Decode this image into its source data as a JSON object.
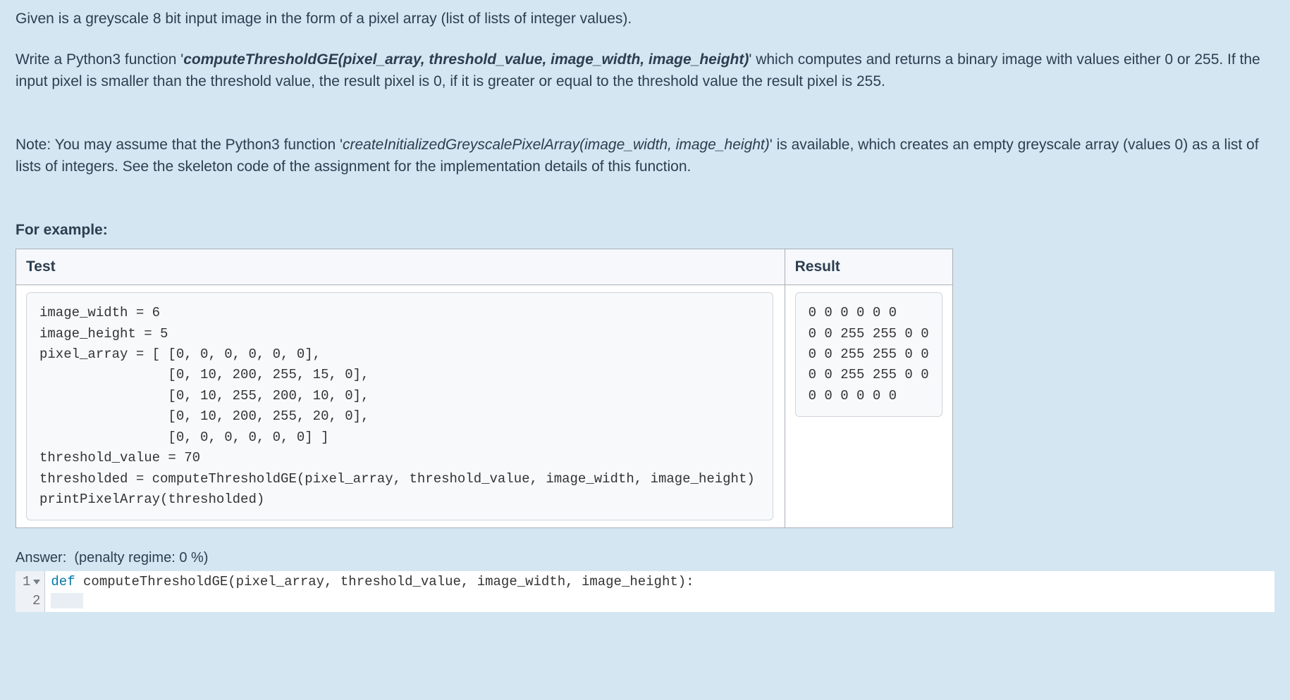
{
  "question": {
    "p1_a": "Given is a greyscale 8 bit input image in the form of a pixel array (list of lists of integer values).",
    "p2_a": "Write a Python3 function '",
    "p2_sig": "computeThresholdGE(pixel_array, threshold_value, image_width, image_height)",
    "p2_b": "' which computes and returns a binary image with values either 0 or 255. If the input pixel is smaller than the threshold value, the result pixel is 0, if it is greater or equal to the threshold value the result pixel is 255.",
    "p3_a": "Note: You may assume that the Python3 function '",
    "p3_sig": "createInitializedGreyscalePixelArray(image_width, image_height)",
    "p3_b": "' is available, which creates an empty greyscale array (values 0) as a list of lists of integers. See the skeleton code of the assignment for the implementation details of this function."
  },
  "example": {
    "label": "For example:",
    "headers": {
      "test": "Test",
      "result": "Result"
    },
    "test_code": "image_width = 6\nimage_height = 5\npixel_array = [ [0, 0, 0, 0, 0, 0],\n                [0, 10, 200, 255, 15, 0],\n                [0, 10, 255, 200, 10, 0],\n                [0, 10, 200, 255, 20, 0],\n                [0, 0, 0, 0, 0, 0] ]\nthreshold_value = 70\nthresholded = computeThresholdGE(pixel_array, threshold_value, image_width, image_height)\nprintPixelArray(thresholded)",
    "result_text": "0 0 0 0 0 0\n0 0 255 255 0 0\n0 0 255 255 0 0\n0 0 255 255 0 0\n0 0 0 0 0 0"
  },
  "answer": {
    "label": "Answer:",
    "penalty": "(penalty regime: 0 %)",
    "line_numbers": [
      "1",
      "2"
    ],
    "code_kw": "def",
    "code_rest": " computeThresholdGE(pixel_array, threshold_value, image_width, image_height):"
  }
}
